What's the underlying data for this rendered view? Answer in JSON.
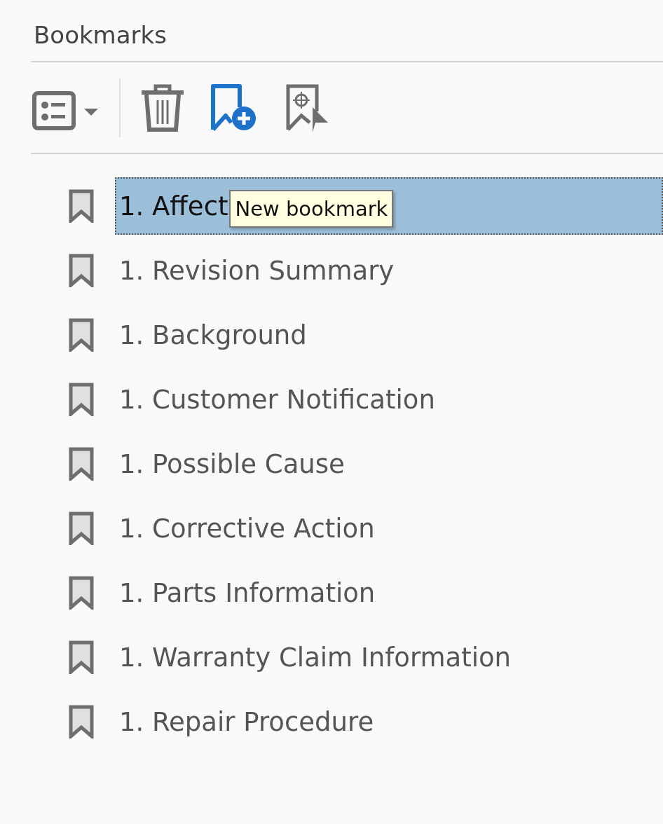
{
  "panel": {
    "title": "Bookmarks"
  },
  "toolbar": {
    "tooltip": "New bookmark"
  },
  "bookmarks": [
    {
      "label": "1. Affect",
      "selected": true
    },
    {
      "label": "1. Revision Summary",
      "selected": false
    },
    {
      "label": "1. Background",
      "selected": false
    },
    {
      "label": "1. Customer Notification",
      "selected": false
    },
    {
      "label": "1. Possible Cause",
      "selected": false
    },
    {
      "label": "1. Corrective Action",
      "selected": false
    },
    {
      "label": "1. Parts Information",
      "selected": false
    },
    {
      "label": "1. Warranty Claim Information",
      "selected": false
    },
    {
      "label": "1. Repair Procedure",
      "selected": false
    }
  ]
}
